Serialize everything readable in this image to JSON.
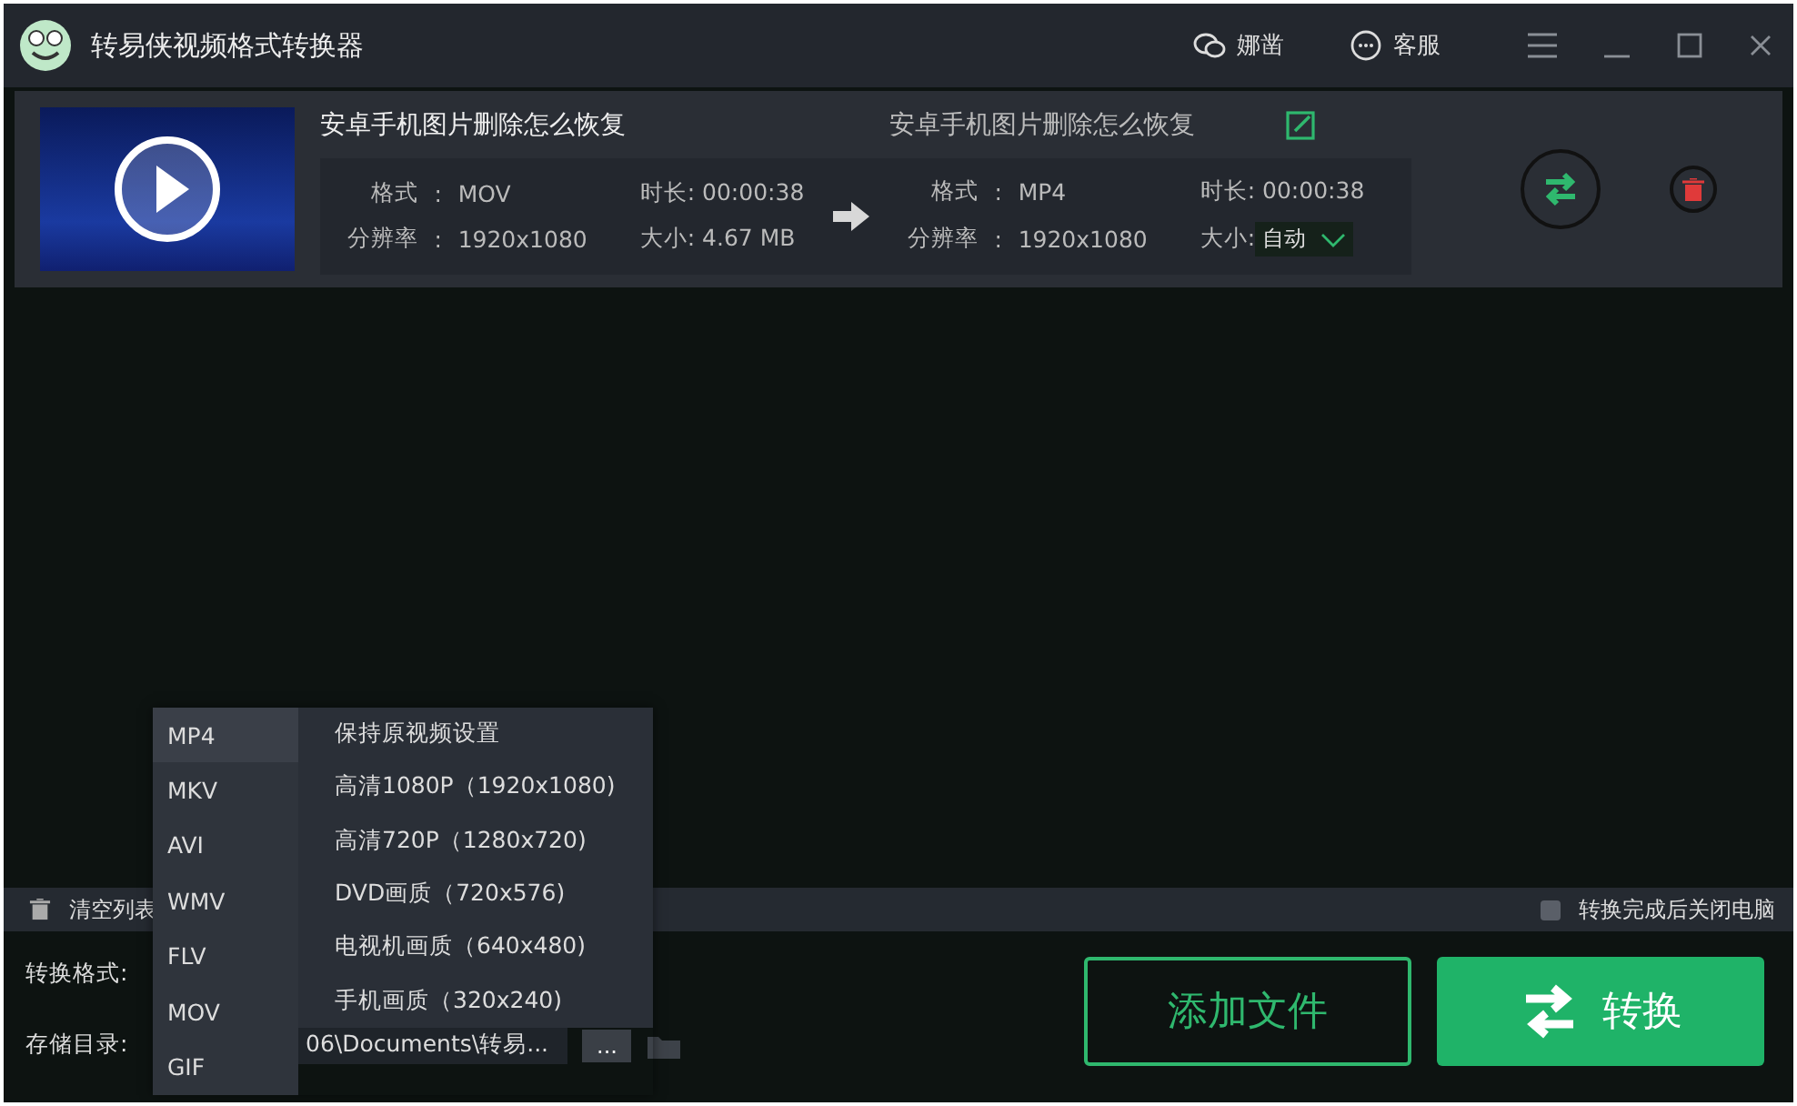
{
  "window": {
    "title": "转易侠视频格式转换器"
  },
  "header_actions": [
    {
      "kind": "wechat",
      "label": "娜凿"
    },
    {
      "kind": "chat",
      "label": "客服"
    }
  ],
  "files": [
    {
      "name": "安卓手机图片删除怎么恢复",
      "output_name": "安卓手机图片删除怎么恢复",
      "source": {
        "separator": ":",
        "format_label": "格式",
        "format": "MOV",
        "resolution_label": "分辨率",
        "resolution": "1920x1080",
        "duration_label": "时长:",
        "duration": "00:00:38",
        "size_label": "大小:",
        "size": "4.67 MB"
      },
      "target": {
        "separator": ":",
        "format_label": "格式",
        "format": "MP4",
        "resolution_label": "分辨率",
        "resolution": "1920x1080",
        "duration_label": "时长:",
        "duration": "00:00:38",
        "size_label": "大小:",
        "size": "自动"
      }
    }
  ],
  "toolbar": {
    "clear_label": "清空列表",
    "shutdown_option": {
      "label": "转换完成后关闭电脑",
      "checked": false
    }
  },
  "format_menu": {
    "formats": [
      {
        "label": "MP4",
        "selected": true
      },
      {
        "label": "MKV",
        "selected": false
      },
      {
        "label": "AVI",
        "selected": false
      },
      {
        "label": "WMV",
        "selected": false
      },
      {
        "label": "FLV",
        "selected": false
      },
      {
        "label": "MOV",
        "selected": false
      },
      {
        "label": "GIF",
        "selected": false
      }
    ],
    "presets": [
      "保持原视频设置",
      "高清1080P（1920x1080)",
      "高清720P（1280x720)",
      "DVD画质（720x576)",
      "电视机画质（640x480)",
      "手机画质（320x240)"
    ]
  },
  "output": {
    "format_label": "转换格式:",
    "dir_label": "存储目录:",
    "dir_value": "06\\Documents\\转易...",
    "browse": "..."
  },
  "buttons": {
    "add": "添加文件",
    "convert": "转换"
  }
}
